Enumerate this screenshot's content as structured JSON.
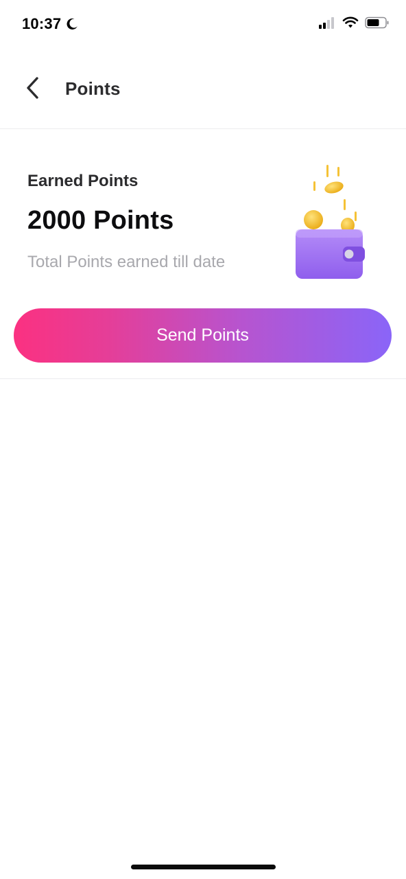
{
  "status_bar": {
    "time": "10:37",
    "icons": [
      "moon-icon",
      "signal-icon",
      "wifi-icon",
      "battery-icon"
    ]
  },
  "header": {
    "back_icon": "chevron-left-icon",
    "title": "Points"
  },
  "points_card": {
    "label": "Earned Points",
    "value": "2000 Points",
    "subtitle": "Total Points earned till date",
    "illustration": "wallet-coins-icon",
    "send_button_label": "Send Points"
  },
  "colors": {
    "gradient_start": "#fb3181",
    "gradient_end": "#8a65f8",
    "wallet": "#a879f5",
    "coin": "#f5c236"
  }
}
